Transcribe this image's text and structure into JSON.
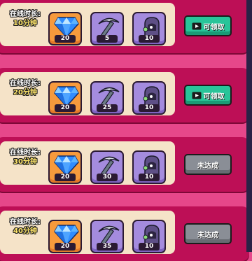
{
  "rewards": [
    {
      "label": "在线时长:",
      "duration": "10分钟",
      "items": [
        {
          "icon": "diamond-icon",
          "qty": "20"
        },
        {
          "icon": "pickaxe-icon",
          "qty": "5"
        },
        {
          "icon": "cloak-icon",
          "qty": "10"
        }
      ],
      "button": {
        "label": "可领取",
        "state": "claimable",
        "icon": "video-icon"
      }
    },
    {
      "label": "在线时长:",
      "duration": "20分钟",
      "items": [
        {
          "icon": "diamond-icon",
          "qty": "20"
        },
        {
          "icon": "pickaxe-icon",
          "qty": "25"
        },
        {
          "icon": "cloak-icon",
          "qty": "10"
        }
      ],
      "button": {
        "label": "可领取",
        "state": "claimable",
        "icon": "video-icon"
      }
    },
    {
      "label": "在线时长:",
      "duration": "30分钟",
      "items": [
        {
          "icon": "diamond-icon",
          "qty": "20"
        },
        {
          "icon": "pickaxe-icon",
          "qty": "30"
        },
        {
          "icon": "cloak-icon",
          "qty": "10"
        }
      ],
      "button": {
        "label": "未达成",
        "state": "locked"
      }
    },
    {
      "label": "在线时长:",
      "duration": "40分钟",
      "items": [
        {
          "icon": "diamond-icon",
          "qty": "20"
        },
        {
          "icon": "pickaxe-icon",
          "qty": "35"
        },
        {
          "icon": "cloak-icon",
          "qty": "10"
        }
      ],
      "button": {
        "label": "未达成",
        "state": "locked"
      }
    }
  ],
  "colors": {
    "row": "#bd0f56",
    "panel": "#f5e3c8",
    "claim_button": "#29c499",
    "locked_button": "#8a8e96"
  }
}
